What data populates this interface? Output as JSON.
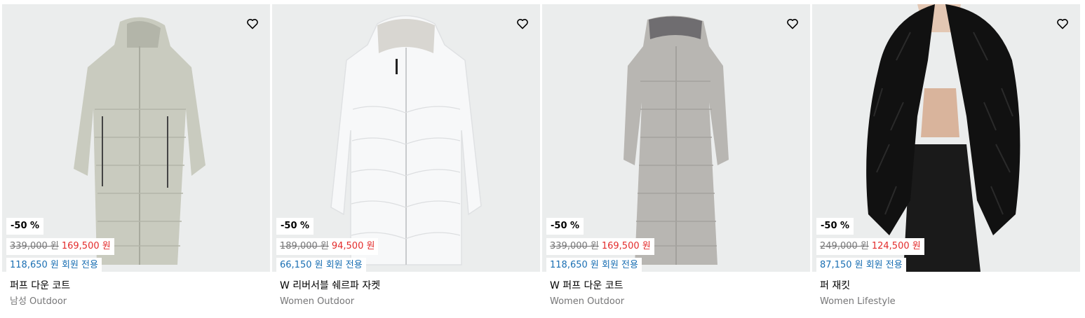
{
  "products": [
    {
      "discount": "-50 %",
      "original_price": "339,000 원",
      "sale_price": "169,500 원",
      "member_price": "118,650 원 회원 전용",
      "name": "퍼프 다운 코트",
      "category": "남성 Outdoor",
      "wishlist_icon": "heart-icon"
    },
    {
      "discount": "-50 %",
      "original_price": "189,000 원",
      "sale_price": "94,500 원",
      "member_price": "66,150 원 회원 전용",
      "name": "W 리버서블 쉐르파 자켓",
      "category": "Women Outdoor",
      "wishlist_icon": "heart-icon"
    },
    {
      "discount": "-50 %",
      "original_price": "339,000 원",
      "sale_price": "169,500 원",
      "member_price": "118,650 원 회원 전용",
      "name": "W 퍼프 다운 코트",
      "category": "Women Outdoor",
      "wishlist_icon": "heart-icon"
    },
    {
      "discount": "-50 %",
      "original_price": "249,000 원",
      "sale_price": "124,500 원",
      "member_price": "87,150 원 회원 전용",
      "name": "퍼 재킷",
      "category": "Women Lifestyle",
      "wishlist_icon": "heart-icon"
    }
  ],
  "colors": {
    "sale": "#e32b2b",
    "member": "#1a6fb3",
    "muted": "#767677",
    "tile_bg": "#ebeded"
  }
}
